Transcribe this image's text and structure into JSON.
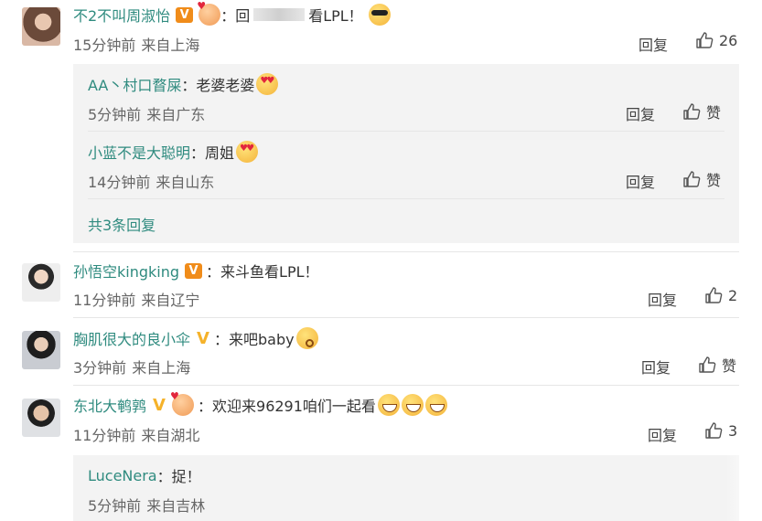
{
  "comments": [
    {
      "username": "不2不叫周淑怡",
      "text_prefix": "：回",
      "text_suffix": "看LPL！",
      "time": "15分钟前",
      "location": "来自上海",
      "reply_label": "回复",
      "likes": "26",
      "emoji": "sunglasses-emoji",
      "replies": [
        {
          "username": "AA丶村口瞀屎",
          "text": "：老婆老婆",
          "time": "5分钟前",
          "location": "来自广东",
          "reply_label": "回复",
          "like_label": "赞",
          "emoji": "heart-eyes-emoji"
        },
        {
          "username": "小蓝不是大聪明",
          "text": "：周姐",
          "time": "14分钟前",
          "location": "来自山东",
          "reply_label": "回复",
          "like_label": "赞",
          "emoji": "heart-eyes-emoji"
        }
      ],
      "more_replies": "共3条回复"
    },
    {
      "username": "孙悟空kingking",
      "text": "：来斗鱼看LPL！",
      "time": "11分钟前",
      "location": "来自辽宁",
      "reply_label": "回复",
      "likes": "2"
    },
    {
      "username": "胸肌很大的良小伞",
      "text": "：来吧baby",
      "time": "3分钟前",
      "location": "来自上海",
      "reply_label": "回复",
      "like_label": "赞",
      "emoji": "kiss-emoji"
    },
    {
      "username": "东北大鹌鹑",
      "text": "：欢迎来96291咱们一起看",
      "time": "11分钟前",
      "location": "来自湖北",
      "reply_label": "回复",
      "likes": "3",
      "emoji": "grin-emoji",
      "replies": [
        {
          "username": "LuceNera",
          "text": "：捉！",
          "time": "5分钟前",
          "location": "来自吉林"
        }
      ]
    }
  ],
  "colors": {
    "username": "#2f8b7f",
    "subbox": "#f3f3f3",
    "vip_badge": "#f08c1a",
    "gold_v": "#f5b22a"
  }
}
